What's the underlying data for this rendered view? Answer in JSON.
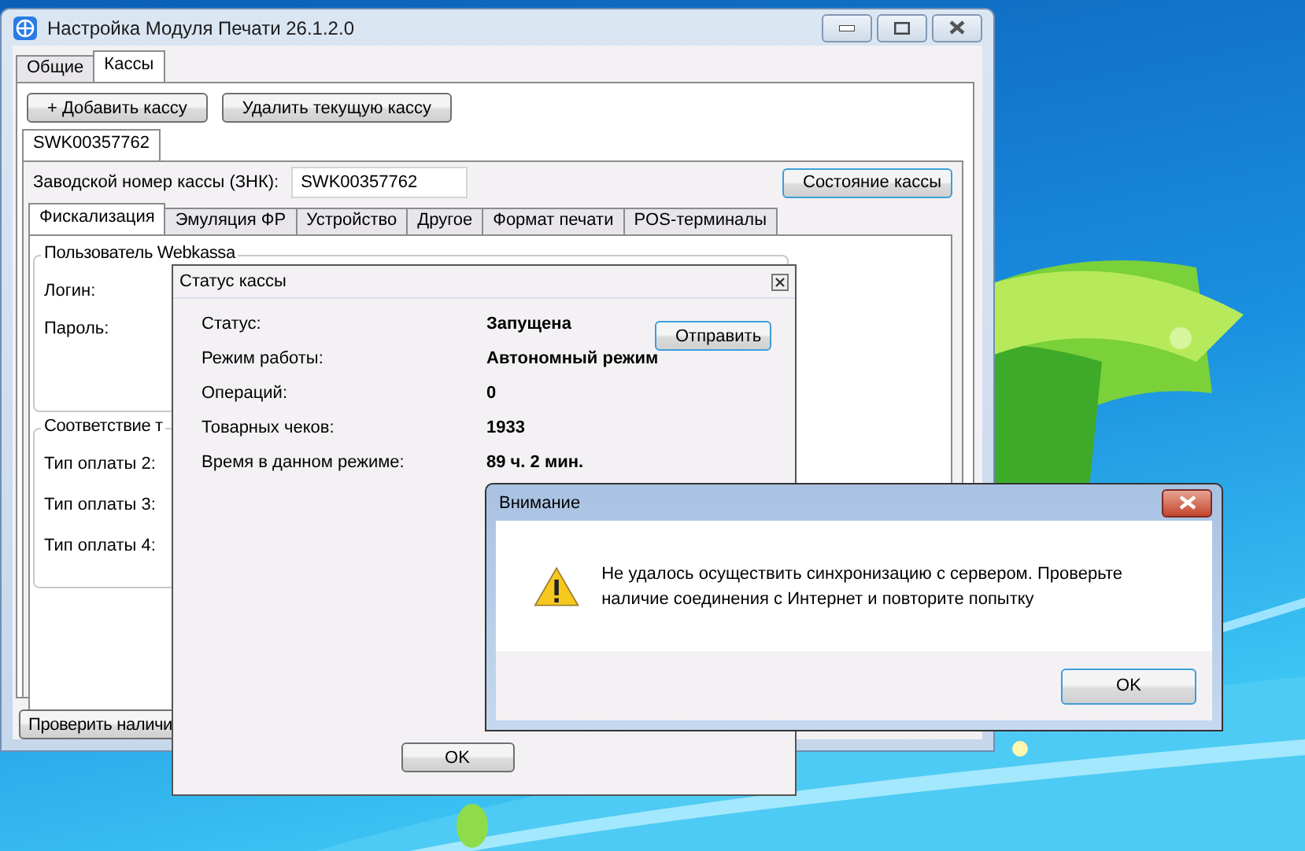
{
  "main_window": {
    "title": "Настройка Модуля Печати 26.1.2.0",
    "tabs": [
      {
        "label": "Общие",
        "selected": false
      },
      {
        "label": "Кассы",
        "selected": true
      }
    ],
    "buttons": [
      "+ Добавить кассу",
      "Удалить текущую кассу"
    ],
    "register_tabs": [
      {
        "label": "SWK00357762",
        "selected": true
      }
    ],
    "serial_label": "Заводской номер кассы (ЗНК):",
    "serial_value": "SWK00357762",
    "status_button": "Состояние кассы",
    "section_tabs": [
      {
        "label": "Фискализация",
        "selected": true
      },
      {
        "label": "Эмуляция ФР",
        "selected": false
      },
      {
        "label": "Устройство",
        "selected": false
      },
      {
        "label": "Другое",
        "selected": false
      },
      {
        "label": "Формат печати",
        "selected": false
      },
      {
        "label": "POS-терминалы",
        "selected": false
      }
    ],
    "groups": [
      {
        "title": "Пользователь Webkassa",
        "fields": [
          "Логин:",
          "Пароль:"
        ]
      },
      {
        "title": "Соответствие т",
        "fields": [
          "Тип оплаты 2:",
          "Тип оплаты 3:",
          "Тип оплаты 4:"
        ]
      }
    ],
    "bottom_button": "Проверить наличи"
  },
  "status_dialog": {
    "title": "Статус кассы",
    "rows": [
      {
        "label": "Статус:",
        "value": "Запущена"
      },
      {
        "label": "Режим работы:",
        "value": "Автономный режим"
      },
      {
        "label": "Операций:",
        "value": "0"
      },
      {
        "label": "Товарных чеков:",
        "value": "1933"
      },
      {
        "label": "Время в данном режиме:",
        "value": "89 ч. 2 мин."
      }
    ],
    "send_button": "Отправить",
    "ok_button": "OK"
  },
  "alert_dialog": {
    "title": "Внимание",
    "message": "Не удалось осуществить синхронизацию с сервером. Проверьте наличие соединения с Интернет и повторите попытку",
    "ok_button": "OK"
  }
}
